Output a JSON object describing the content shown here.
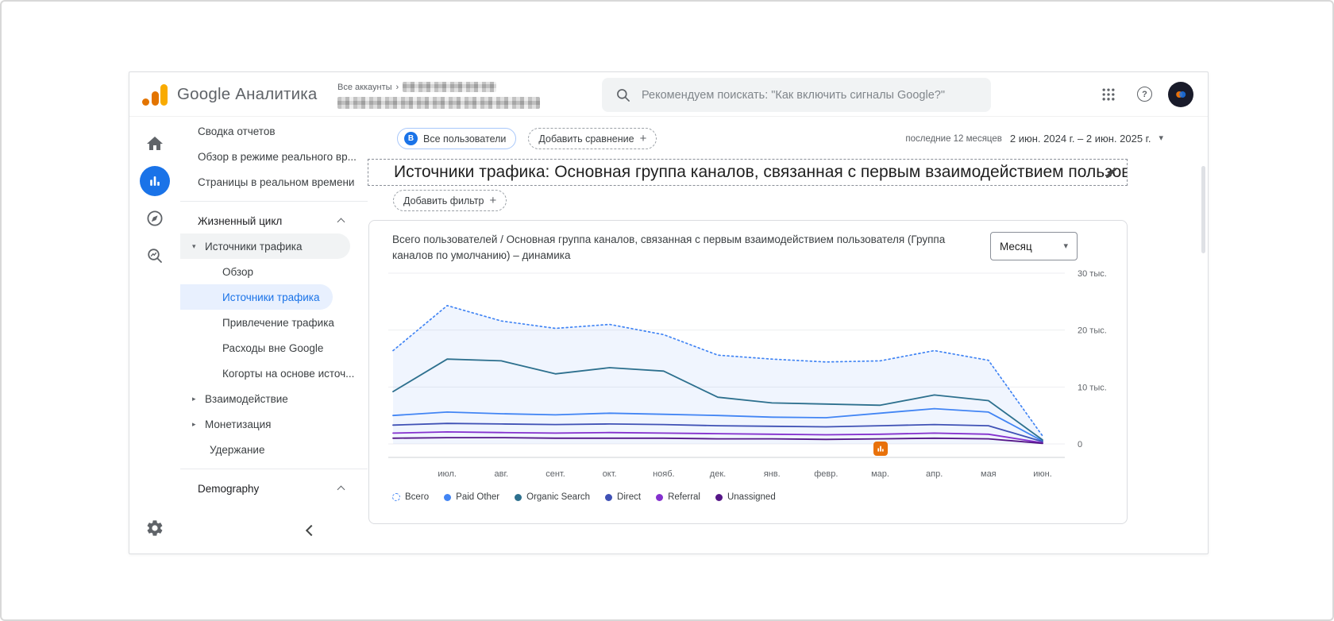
{
  "header": {
    "app_name": "Google Аналитика",
    "breadcrumb_all_accounts": "Все аккаунты",
    "breadcrumb_separator": "›",
    "search_placeholder": "Рекомендуем поискать: \"Как включить сигналы Google?\""
  },
  "icons": {
    "plus": "+",
    "caret_down": "▾",
    "tri_down": "▾",
    "tri_right": "▸"
  },
  "nav": {
    "items": [
      {
        "label": "Сводка отчетов",
        "type": "link"
      },
      {
        "label": "Обзор в режиме реального вр...",
        "type": "link"
      },
      {
        "label": "Страницы в реальном времени",
        "type": "link"
      },
      {
        "label": "Жизненный цикл",
        "type": "section"
      },
      {
        "label": "Источники трафика",
        "type": "parent-expanded"
      },
      {
        "label": "Обзор",
        "type": "child"
      },
      {
        "label": "Источники трафика",
        "type": "child",
        "selected": true
      },
      {
        "label": "Привлечение трафика",
        "type": "child"
      },
      {
        "label": "Расходы вне Google",
        "type": "child"
      },
      {
        "label": "Когорты на основе источ...",
        "type": "child"
      },
      {
        "label": "Взаимодействие",
        "type": "parent-collapsed"
      },
      {
        "label": "Монетизация",
        "type": "parent-collapsed"
      },
      {
        "label": "Удержание",
        "type": "plain"
      },
      {
        "label": "Demography",
        "type": "section"
      }
    ]
  },
  "toolbar": {
    "audience_badge": "В",
    "audience_chip": "Все пользователи",
    "add_comparison": "Добавить сравнение",
    "date_range_label": "последние 12 месяцев",
    "date_range": "2 июн. 2024 г. – 2 июн. 2025 г.",
    "add_filter": "Добавить фильтр"
  },
  "report": {
    "title": "Источники трафика: Основная группа каналов, связанная с первым взаимодействием пользователя (Груп",
    "card_title": "Всего пользователей / Основная группа каналов, связанная с первым взаимодействием пользователя (Группа каналов по умолчанию) – динамика",
    "granularity": "Месяц"
  },
  "colors": {
    "accent": "#1a73e8",
    "selected_nav_bg": "#e8f0fe",
    "search_bg": "#f1f3f4",
    "logo_amber": "#f9ab00",
    "logo_orange": "#e37400",
    "insight_orange": "#e8710a"
  },
  "chart_data": {
    "type": "line",
    "title": "Всего пользователей / Основная группа каналов, связанная с первым взаимодействием пользователя (Группа каналов по умолчанию) – динамика",
    "values_unit": "thousands of users",
    "ylim": [
      0,
      30
    ],
    "y_ticks": [
      {
        "value": 30,
        "label": "30 тыс."
      },
      {
        "value": 20,
        "label": "20 тыс."
      },
      {
        "value": 10,
        "label": "10 тыс."
      },
      {
        "value": 0,
        "label": "0"
      }
    ],
    "x_labels": [
      "июл.",
      "авг.",
      "сент.",
      "окт.",
      "нояб.",
      "дек.",
      "янв.",
      "февр.",
      "мар.",
      "апр.",
      "мая",
      "июн."
    ],
    "note": "13 monthly points; the first point (июн. 2024) precedes the first axis label",
    "legend_position": "bottom",
    "grid": true,
    "insight_marker_month": "мар.",
    "series": [
      {
        "name": "Всего",
        "style": "dotted",
        "color": "#4285f4",
        "fill": "rgba(66,133,244,0.08)",
        "values": [
          16.4,
          24.3,
          21.6,
          20.3,
          21.0,
          19.2,
          15.6,
          14.9,
          14.4,
          14.6,
          16.4,
          14.7,
          1.4
        ]
      },
      {
        "name": "Paid Other",
        "style": "solid",
        "color": "#4285f4",
        "values": [
          5.0,
          5.6,
          5.3,
          5.1,
          5.4,
          5.2,
          5.0,
          4.7,
          4.6,
          5.4,
          6.2,
          5.6,
          0.5
        ]
      },
      {
        "name": "Organic Search",
        "style": "solid",
        "color": "#2d708e",
        "values": [
          9.2,
          14.9,
          14.6,
          12.3,
          13.4,
          12.8,
          8.2,
          7.2,
          7.0,
          6.8,
          8.6,
          7.6,
          0.7
        ]
      },
      {
        "name": "Direct",
        "style": "solid",
        "color": "#3f51b5",
        "values": [
          3.3,
          3.6,
          3.5,
          3.4,
          3.5,
          3.4,
          3.2,
          3.1,
          3.0,
          3.2,
          3.4,
          3.2,
          0.4
        ]
      },
      {
        "name": "Referral",
        "style": "solid",
        "color": "#8430ce",
        "values": [
          1.9,
          2.1,
          2.0,
          1.9,
          2.0,
          1.9,
          1.8,
          1.7,
          1.6,
          1.7,
          1.9,
          1.7,
          0.2
        ]
      },
      {
        "name": "Unassigned",
        "style": "solid",
        "color": "#551687",
        "values": [
          1.0,
          1.1,
          1.1,
          1.0,
          1.0,
          1.0,
          0.9,
          0.9,
          0.8,
          0.9,
          1.0,
          0.9,
          0.1
        ]
      }
    ]
  }
}
